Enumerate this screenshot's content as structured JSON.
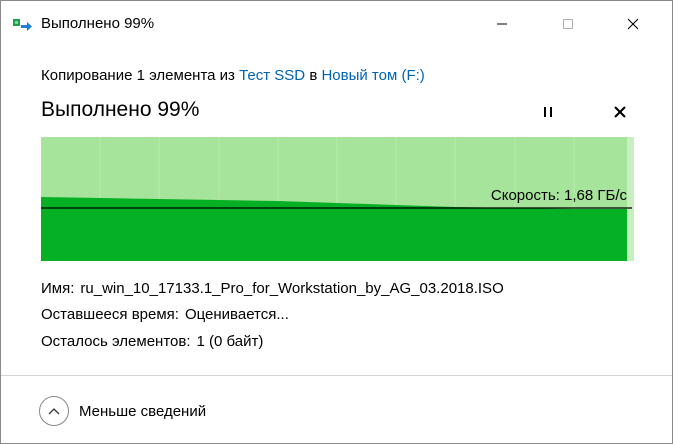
{
  "window": {
    "title": "Выполнено 99%",
    "icon": "copy-files-icon",
    "controls": [
      "minimize-icon",
      "maximize-icon",
      "close-icon"
    ]
  },
  "copy": {
    "prefix": "Копирование 1 элемента из",
    "source": "Тест SSD",
    "middle": "в",
    "destination": "Новый том (F:)",
    "link_color": "#0063b1"
  },
  "status": {
    "title": "Выполнено 99%",
    "progress_percent": 99
  },
  "graph": {
    "speed_label": "Скорость: 1,68 ГБ/с",
    "fill_color": "#06b025",
    "background_color": "#a6e39b",
    "grid_color": "#bcebb2",
    "line_color": "#000000"
  },
  "details": {
    "name_label": "Имя:",
    "name_value": "ru_win_10_17133.1_Pro_for_Workstation_by_AG_03.2018.ISO",
    "time_label": "Оставшееся время:",
    "time_value": "Оценивается...",
    "items_label": "Осталось элементов:",
    "items_value": "1 (0 байт)"
  },
  "footer": {
    "toggle_label": "Меньше сведений",
    "toggle_icon": "chevron-up-icon"
  }
}
